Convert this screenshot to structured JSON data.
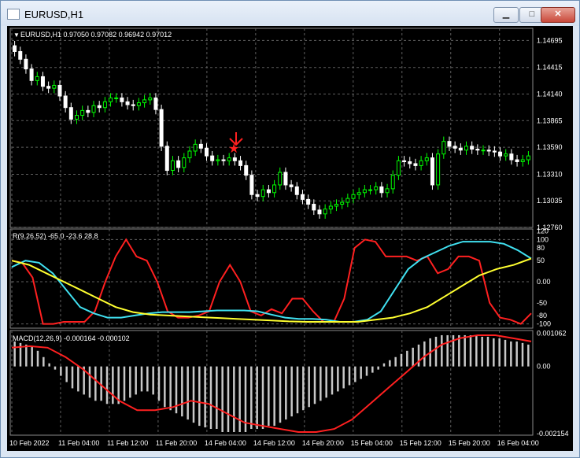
{
  "window": {
    "title": "EURUSD,H1",
    "buttons": {
      "minimize": "▁",
      "maximize": "□",
      "close": "✕"
    }
  },
  "colors": {
    "background": "#000000",
    "bull": "#00ff00",
    "bear": "#ffffff",
    "grid": "#5f5f5f",
    "red": "#ff2020",
    "aqua": "#40e0f0",
    "yellow": "#ffff30",
    "hist": "#c8c8c8"
  },
  "chart_data": [
    {
      "type": "candlestick",
      "title": "EURUSD,H1  0.97050 0.97082 0.96942 0.97012",
      "yticks": [
        "1.14695",
        "1.14415",
        "1.14140",
        "1.13865",
        "1.13590",
        "1.13310",
        "1.13035",
        "1.12760"
      ],
      "ylim": [
        1.1276,
        1.1482
      ],
      "close": [
        1.1458,
        1.145,
        1.144,
        1.1428,
        1.1432,
        1.1422,
        1.142,
        1.1423,
        1.1412,
        1.14,
        1.1388,
        1.1392,
        1.1397,
        1.1395,
        1.1402,
        1.14,
        1.1406,
        1.141,
        1.141,
        1.1406,
        1.1403,
        1.1402,
        1.1405,
        1.1408,
        1.141,
        1.1398,
        1.136,
        1.1335,
        1.1345,
        1.1338,
        1.1348,
        1.1355,
        1.1362,
        1.1358,
        1.135,
        1.1345,
        1.1346,
        1.1345,
        1.1348,
        1.1345,
        1.134,
        1.133,
        1.131,
        1.1308,
        1.1315,
        1.1312,
        1.132,
        1.1333,
        1.132,
        1.1318,
        1.131,
        1.1305,
        1.13,
        1.1294,
        1.129,
        1.1295,
        1.1298,
        1.13,
        1.1302,
        1.1306,
        1.131,
        1.1312,
        1.1315,
        1.1315,
        1.1318,
        1.1312,
        1.1316,
        1.133,
        1.1345,
        1.1344,
        1.1342,
        1.134,
        1.1345,
        1.1348,
        1.132,
        1.1352,
        1.1365,
        1.136,
        1.1358,
        1.1356,
        1.136,
        1.1357,
        1.1356,
        1.1356,
        1.1355,
        1.1354,
        1.135,
        1.1352,
        1.1346,
        1.1344,
        1.1346,
        1.135
      ],
      "x_labels": [
        "10 Feb 2022",
        "11 Feb 04:00",
        "11 Feb 12:00",
        "11 Feb 20:00",
        "14 Feb 04:00",
        "14 Feb 12:00",
        "14 Feb 20:00",
        "15 Feb 04:00",
        "15 Feb 12:00",
        "15 Feb 20:00",
        "16 Feb 04:00"
      ]
    },
    {
      "type": "line",
      "title": "R(9,26,52) -65.0 -23.6 28.8",
      "yticks": [
        "120",
        "100",
        "80",
        "50",
        "0.00",
        "-50",
        "-80",
        "-100"
      ],
      "ylim": [
        -110,
        125
      ],
      "series": [
        {
          "color": "red",
          "values": [
            50,
            45,
            10,
            -100,
            -100,
            -95,
            -95,
            -95,
            -70,
            0,
            60,
            100,
            60,
            50,
            0,
            -70,
            -85,
            -85,
            -80,
            -70,
            0,
            40,
            0,
            -70,
            -80,
            -65,
            -75,
            -40,
            -40,
            -70,
            -95,
            -95,
            -40,
            80,
            100,
            95,
            60,
            60,
            60,
            50,
            60,
            20,
            30,
            60,
            60,
            50,
            -50,
            -85,
            -90,
            -100,
            -75
          ]
        },
        {
          "color": "aqua",
          "values": [
            35,
            50,
            45,
            20,
            -20,
            -60,
            -75,
            -85,
            -85,
            -80,
            -75,
            -72,
            -72,
            -72,
            -70,
            -68,
            -68,
            -68,
            -70,
            -78,
            -85,
            -88,
            -88,
            -90,
            -95,
            -95,
            -90,
            -70,
            -20,
            30,
            55,
            70,
            85,
            95,
            95,
            95,
            90,
            75,
            55
          ]
        },
        {
          "color": "yellow",
          "values": [
            50,
            40,
            20,
            0,
            -20,
            -40,
            -60,
            -72,
            -78,
            -80,
            -82,
            -84,
            -86,
            -88,
            -90,
            -92,
            -94,
            -95,
            -95,
            -95,
            -95,
            -90,
            -85,
            -75,
            -60,
            -35,
            -10,
            15,
            30,
            40,
            55
          ]
        }
      ]
    },
    {
      "type": "bar",
      "title": "MACD(12,26,9) -0.000164 -0.000102",
      "yticks": [
        "0.001062",
        "0.00",
        "-0.002154"
      ],
      "ylim": [
        -0.0022,
        0.00115
      ],
      "series": [
        {
          "name": "histogram",
          "values": [
            0.0008,
            0.00075,
            0.0007,
            0.00065,
            0.0005,
            0.0003,
            0.0001,
            -0.0001,
            -0.0003,
            -0.0005,
            -0.0007,
            -0.0008,
            -0.0009,
            -0.001,
            -0.0011,
            -0.0011,
            -0.0012,
            -0.0012,
            -0.0012,
            -0.0011,
            -0.001,
            -0.0009,
            -0.0008,
            -0.0008,
            -0.0009,
            -0.0011,
            -0.0013,
            -0.0014,
            -0.0015,
            -0.0016,
            -0.0017,
            -0.0018,
            -0.0019,
            -0.00195,
            -0.002,
            -0.002,
            -0.0021,
            -0.0021,
            -0.0021,
            -0.0021,
            -0.0021,
            -0.002,
            -0.002,
            -0.002,
            -0.0019,
            -0.0019,
            -0.0018,
            -0.0017,
            -0.0016,
            -0.0015,
            -0.0014,
            -0.0013,
            -0.0012,
            -0.0011,
            -0.001,
            -0.0009,
            -0.0008,
            -0.0007,
            -0.0006,
            -0.0005,
            -0.0004,
            -0.0003,
            -0.0002,
            -0.0001,
            0.0001,
            0.0002,
            0.0003,
            0.0004,
            0.0005,
            0.0006,
            0.0007,
            0.0008,
            0.0009,
            0.00095,
            0.001,
            0.001,
            0.001,
            0.001,
            0.001,
            0.001,
            0.001,
            0.00095,
            0.00095,
            0.0009,
            0.0009,
            0.00085,
            0.0008,
            0.0008,
            0.00075,
            0.0007
          ]
        },
        {
          "name": "signal",
          "color": "red",
          "values": [
            0.0006,
            0.00065,
            0.0006,
            0.0003,
            -0.0001,
            -0.0006,
            -0.0011,
            -0.0014,
            -0.0014,
            -0.0013,
            -0.0011,
            -0.0012,
            -0.0015,
            -0.0018,
            -0.0019,
            -0.002,
            -0.0021,
            -0.0021,
            -0.002,
            -0.0017,
            -0.0012,
            -0.0007,
            -0.0002,
            0.0003,
            0.0007,
            0.0009,
            0.001,
            0.001,
            0.0009,
            0.0008
          ]
        }
      ]
    }
  ]
}
